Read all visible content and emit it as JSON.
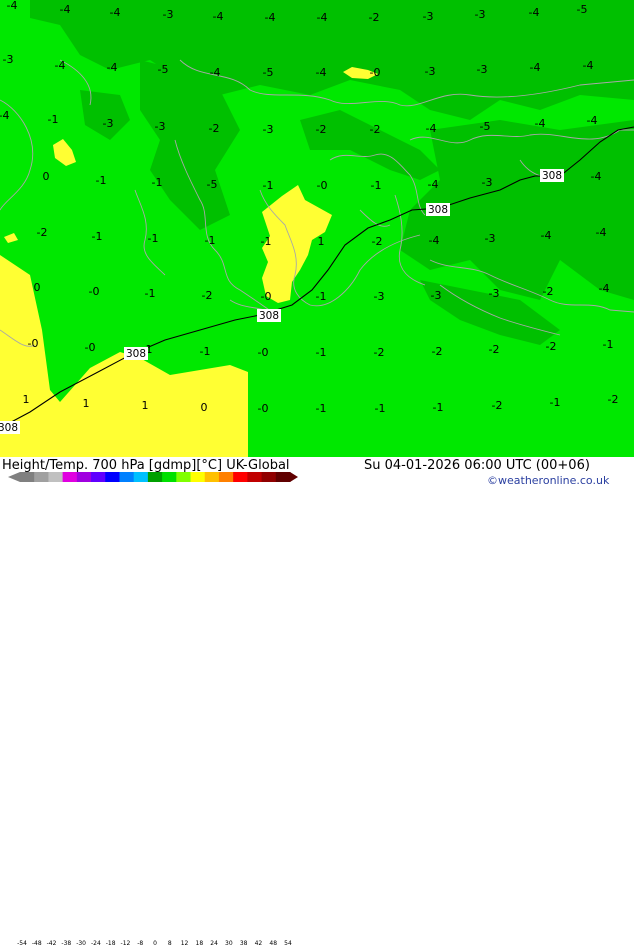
{
  "map": {
    "contour_labels": [
      {
        "text": "-4"
      },
      {
        "text": "-4"
      },
      {
        "text": "-4"
      },
      {
        "text": "-3"
      },
      {
        "text": "-4"
      },
      {
        "text": "-4"
      },
      {
        "text": "-4"
      },
      {
        "text": "-2"
      },
      {
        "text": "-3"
      },
      {
        "text": "-3"
      },
      {
        "text": "-4"
      },
      {
        "text": "-5"
      },
      {
        "text": "-3"
      },
      {
        "text": "-4"
      },
      {
        "text": "-4"
      },
      {
        "text": "-5"
      },
      {
        "text": "-4"
      },
      {
        "text": "-5"
      },
      {
        "text": "-4"
      },
      {
        "text": "-0"
      },
      {
        "text": "-3"
      },
      {
        "text": "-3"
      },
      {
        "text": "-4"
      },
      {
        "text": "-4"
      },
      {
        "text": "-4"
      },
      {
        "text": "-1"
      },
      {
        "text": "-3"
      },
      {
        "text": "-3"
      },
      {
        "text": "-2"
      },
      {
        "text": "-3"
      },
      {
        "text": "-2"
      },
      {
        "text": "-2"
      },
      {
        "text": "-4"
      },
      {
        "text": "-5"
      },
      {
        "text": "-4"
      },
      {
        "text": "-4"
      },
      {
        "text": "0"
      },
      {
        "text": "-1"
      },
      {
        "text": "-1"
      },
      {
        "text": "-5"
      },
      {
        "text": "-1"
      },
      {
        "text": "-0"
      },
      {
        "text": "-1"
      },
      {
        "text": "-4"
      },
      {
        "text": "-3"
      },
      {
        "text": "-4"
      },
      {
        "text": "-2"
      },
      {
        "text": "-1"
      },
      {
        "text": "-1"
      },
      {
        "text": "-1"
      },
      {
        "text": "-1"
      },
      {
        "text": "1"
      },
      {
        "text": "-2"
      },
      {
        "text": "-4"
      },
      {
        "text": "-3"
      },
      {
        "text": "-4"
      },
      {
        "text": "-4"
      },
      {
        "text": "0"
      },
      {
        "text": "-0"
      },
      {
        "text": "-1"
      },
      {
        "text": "-2"
      },
      {
        "text": "-0"
      },
      {
        "text": "-1"
      },
      {
        "text": "-3"
      },
      {
        "text": "-3"
      },
      {
        "text": "-3"
      },
      {
        "text": "-2"
      },
      {
        "text": "-4"
      },
      {
        "text": "-0"
      },
      {
        "text": "-0"
      },
      {
        "text": "-1"
      },
      {
        "text": "-1"
      },
      {
        "text": "-0"
      },
      {
        "text": "-1"
      },
      {
        "text": "-2"
      },
      {
        "text": "-2"
      },
      {
        "text": "-2"
      },
      {
        "text": "-2"
      },
      {
        "text": "-1"
      },
      {
        "text": "1"
      },
      {
        "text": "1"
      },
      {
        "text": "1"
      },
      {
        "text": "0"
      },
      {
        "text": "-0"
      },
      {
        "text": "-1"
      },
      {
        "text": "-1"
      },
      {
        "text": "-1"
      },
      {
        "text": "-2"
      },
      {
        "text": "-1"
      },
      {
        "text": "-2"
      }
    ],
    "height_labels": [
      "308",
      "308",
      "308",
      "308",
      "308"
    ]
  },
  "footer": {
    "title": "Height/Temp. 700 hPa [gdmp][°C] UK-Global",
    "datetime": "Su 04-01-2026 06:00 UTC (00+06)",
    "credit": "©weatheronline.co.uk"
  },
  "colorbar": {
    "ticks": [
      "-54",
      "-48",
      "-42",
      "-38",
      "-30",
      "-24",
      "-18",
      "-12",
      "-8",
      "0",
      "8",
      "12",
      "18",
      "24",
      "30",
      "38",
      "42",
      "48",
      "54"
    ],
    "colors": [
      "#808080",
      "#a0a0a0",
      "#c0c0c0",
      "#e000e0",
      "#a000e0",
      "#6000ff",
      "#0000ff",
      "#0080ff",
      "#00c0ff",
      "#00a000",
      "#00e000",
      "#80ff00",
      "#ffff00",
      "#ffc000",
      "#ff8000",
      "#ff0000",
      "#c00000",
      "#900000",
      "#600000"
    ]
  }
}
